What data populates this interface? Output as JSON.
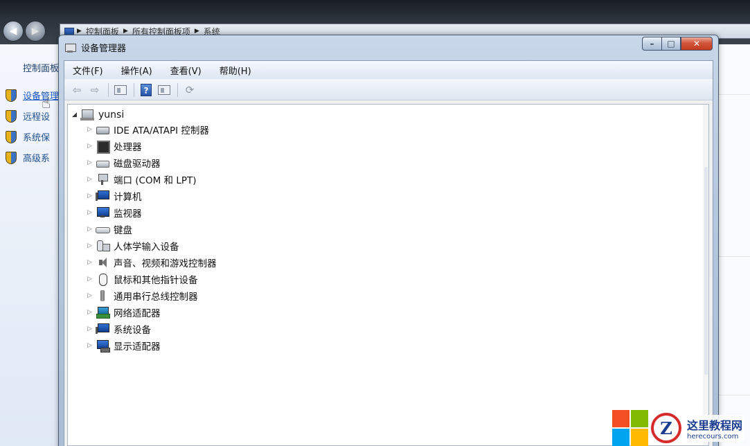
{
  "background_window": {
    "breadcrumb": [
      "控制面板",
      "所有控制面板项",
      "系统"
    ],
    "left_pane": {
      "home_link": "控制面板",
      "links": [
        {
          "label": "设备管理",
          "icon": "shield-icon",
          "hovered": true
        },
        {
          "label": "远程设",
          "icon": "shield-icon"
        },
        {
          "label": "系统保",
          "icon": "shield-icon"
        },
        {
          "label": "高级系",
          "icon": "shield-icon"
        }
      ]
    }
  },
  "device_manager": {
    "title": "设备管理器",
    "window_buttons": {
      "minimize": "–",
      "maximize": "□",
      "close": "✕"
    },
    "menu": [
      "文件(F)",
      "操作(A)",
      "查看(V)",
      "帮助(H)"
    ],
    "toolbar": [
      {
        "icon": "back-arrow-icon",
        "glyph": "⇦"
      },
      {
        "icon": "forward-arrow-icon",
        "glyph": "⇨"
      },
      {
        "icon": "show-hide-console-tree-icon"
      },
      {
        "icon": "help-icon",
        "glyph": "?"
      },
      {
        "icon": "properties-pane-icon"
      },
      {
        "icon": "scan-hardware-icon",
        "glyph": "⟳"
      }
    ],
    "tree": {
      "root": "yunsi",
      "root_expanded": true,
      "categories": [
        {
          "label": "IDE ATA/ATAPI 控制器",
          "icon": "ide-controller-icon"
        },
        {
          "label": "处理器",
          "icon": "processor-icon"
        },
        {
          "label": "磁盘驱动器",
          "icon": "disk-drive-icon"
        },
        {
          "label": "端口 (COM 和 LPT)",
          "icon": "port-icon"
        },
        {
          "label": "计算机",
          "icon": "computer-icon"
        },
        {
          "label": "监视器",
          "icon": "monitor-icon"
        },
        {
          "label": "键盘",
          "icon": "keyboard-icon"
        },
        {
          "label": "人体学输入设备",
          "icon": "hid-icon"
        },
        {
          "label": "声音、视频和游戏控制器",
          "icon": "speaker-icon"
        },
        {
          "label": "鼠标和其他指针设备",
          "icon": "mouse-icon"
        },
        {
          "label": "通用串行总线控制器",
          "icon": "usb-icon"
        },
        {
          "label": "网络适配器",
          "icon": "network-adapter-icon"
        },
        {
          "label": "系统设备",
          "icon": "system-device-icon"
        },
        {
          "label": "显示适配器",
          "icon": "display-adapter-icon"
        }
      ]
    }
  },
  "watermark": {
    "cn": "这里教程网",
    "en": "herecours.com",
    "letter": "Z"
  },
  "colors": {
    "win_red": "#f25022",
    "win_green": "#7fba00",
    "win_blue": "#00a4ef",
    "win_yellow": "#ffb900",
    "close_red": "#c23b1f"
  }
}
